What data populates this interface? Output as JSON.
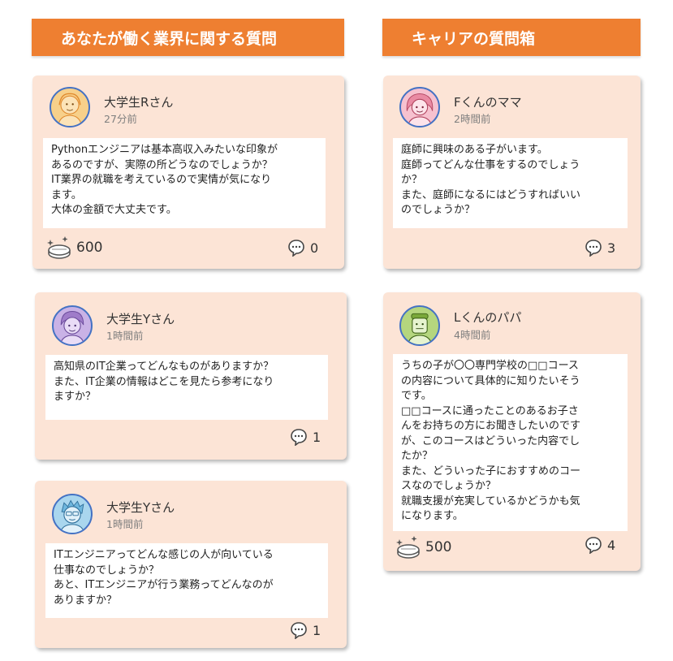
{
  "headers": {
    "industry": "あなたが働く業界に関する質問",
    "career": "キャリアの質問箱"
  },
  "cards": [
    {
      "user": "大学生Rさん",
      "time": "27分前",
      "lines": [
        "Pythonエンジニアは基本高収入みたいな印象が",
        "あるのですが、実際の所どうなのでしょうか？",
        "IT業界の就職を考えているので実情が気になり",
        "ます。",
        "大体の金額で大丈夫です。"
      ],
      "coins": "600",
      "comments": "0",
      "avatar_color": "#f7d08a"
    },
    {
      "user": "大学生Yさん",
      "time": "1時間前",
      "lines": [
        "高知県のIT企業ってどんなものがありますか？",
        "また、IT企業の情報はどこを見たら参考になり",
        "ますか？"
      ],
      "comments": "1",
      "avatar_color": "#c9b2e6"
    },
    {
      "user": "大学生Yさん",
      "time": "1時間前",
      "lines": [
        "ITエンジニアってどんな感じの人が向いている",
        "仕事なのでしょうか？",
        "あと、ITエンジニアが行う業務ってどんなのが",
        "ありますか？"
      ],
      "comments": "1",
      "avatar_color": "#a9d6ee"
    },
    {
      "user": "Fくんのママ",
      "time": "2時間前",
      "lines": [
        "庭師に興味のある子がいます。",
        "庭師ってどんな仕事をするのでしょう",
        "か？",
        "また、庭師になるにはどうすればいい",
        "のでしょうか？"
      ],
      "comments": "3",
      "avatar_color": "#f6c1cf"
    },
    {
      "user": "Lくんのパパ",
      "time": "4時間前",
      "lines": [
        "うちの子が〇〇専門学校の□□コース",
        "の内容について具体的に知りたいそう",
        "です。",
        "□□コースに通ったことのあるお子さ",
        "んをお持ちの方にお聞きしたいのです",
        "が、このコースはどういった内容でし",
        "たか？",
        "また、どういった子におすすめのコー",
        "スなのでしょうか？",
        "就職支援が充実しているかどうかも気",
        "になります。"
      ],
      "coins": "500",
      "comments": "4",
      "avatar_color": "#b5d67e"
    }
  ],
  "icons": {
    "avatar": "avatar-icon",
    "comment": "comment-icon",
    "coin": "coin-icon"
  },
  "colors": {
    "header_bg": "#ee7f31",
    "card_bg": "#fce4d6",
    "avatar_border": "#4472c4"
  }
}
